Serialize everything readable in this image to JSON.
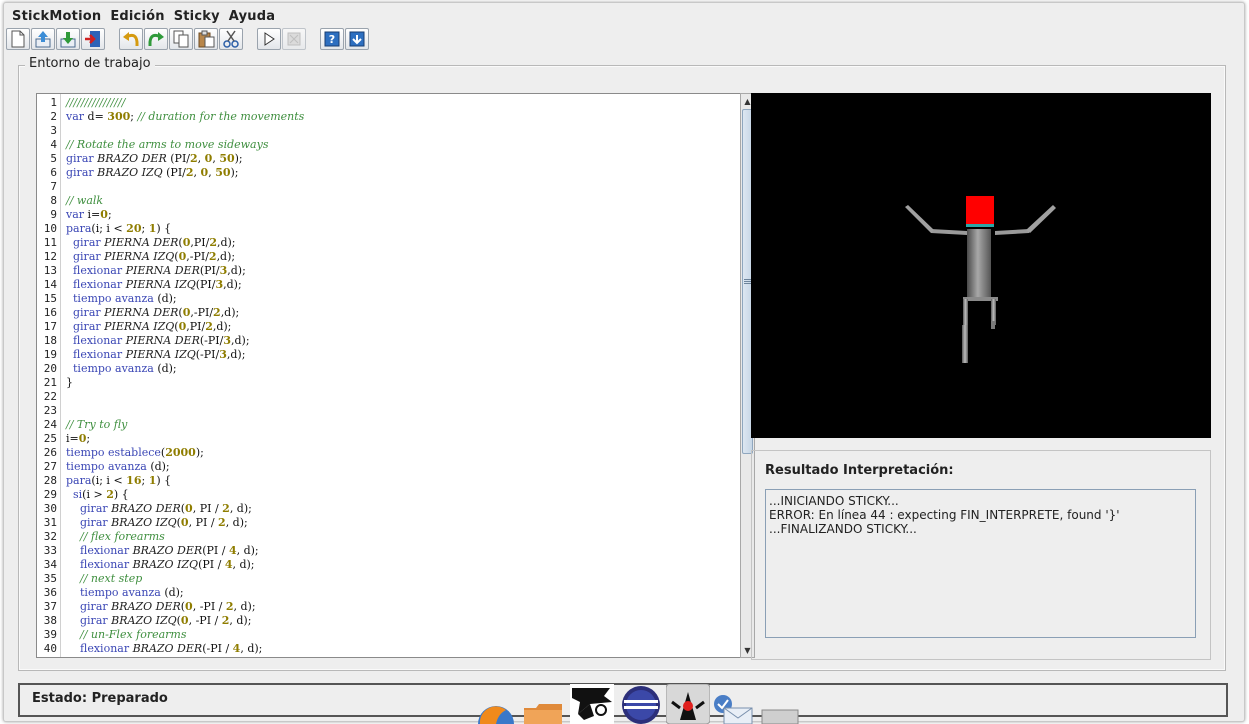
{
  "menu": [
    "StickMotion",
    "Edición",
    "Sticky",
    "Ayuda"
  ],
  "toolbar": [
    {
      "name": "new-file-icon",
      "disabled": false
    },
    {
      "name": "open-file-icon",
      "disabled": false
    },
    {
      "name": "save-file-icon",
      "disabled": false
    },
    {
      "name": "exit-icon",
      "disabled": false
    },
    {
      "gap": true
    },
    {
      "name": "undo-icon",
      "disabled": false
    },
    {
      "name": "redo-icon",
      "disabled": false
    },
    {
      "name": "copy-icon",
      "disabled": false
    },
    {
      "name": "paste-icon",
      "disabled": false
    },
    {
      "name": "cut-icon",
      "disabled": false
    },
    {
      "gap": true
    },
    {
      "name": "play-icon",
      "disabled": false
    },
    {
      "name": "stop-icon",
      "disabled": true
    },
    {
      "gap": true
    },
    {
      "name": "help-icon",
      "disabled": false
    },
    {
      "name": "info-icon",
      "disabled": false
    }
  ],
  "workspace_title": "Entorno de trabajo",
  "code_lines": [
    [
      [
        "c",
        "////////////////"
      ]
    ],
    [
      [
        "k",
        "var "
      ],
      [
        "p",
        "d= "
      ],
      [
        "n",
        "300"
      ],
      [
        "p",
        "; "
      ],
      [
        "c",
        "// duration for the movements"
      ]
    ],
    [],
    [
      [
        "c",
        "// Rotate the arms to move sideways"
      ]
    ],
    [
      [
        "k",
        "girar "
      ],
      [
        "i",
        "BRAZO DER "
      ],
      [
        "p",
        "(PI/"
      ],
      [
        "n",
        "2"
      ],
      [
        "p",
        ", "
      ],
      [
        "n",
        "0"
      ],
      [
        "p",
        ", "
      ],
      [
        "n",
        "50"
      ],
      [
        "p",
        ");"
      ]
    ],
    [
      [
        "k",
        "girar "
      ],
      [
        "i",
        "BRAZO IZQ "
      ],
      [
        "p",
        "(PI/"
      ],
      [
        "n",
        "2"
      ],
      [
        "p",
        ", "
      ],
      [
        "n",
        "0"
      ],
      [
        "p",
        ", "
      ],
      [
        "n",
        "50"
      ],
      [
        "p",
        ");"
      ]
    ],
    [],
    [
      [
        "c",
        "// walk"
      ]
    ],
    [
      [
        "k",
        "var "
      ],
      [
        "p",
        "i="
      ],
      [
        "n",
        "0"
      ],
      [
        "p",
        ";"
      ]
    ],
    [
      [
        "k",
        "para"
      ],
      [
        "p",
        "(i; i < "
      ],
      [
        "n",
        "20"
      ],
      [
        "p",
        "; "
      ],
      [
        "n",
        "1"
      ],
      [
        "p",
        ") {"
      ]
    ],
    [
      [
        "p",
        "  "
      ],
      [
        "k",
        "girar "
      ],
      [
        "i",
        "PIERNA DER"
      ],
      [
        "p",
        "("
      ],
      [
        "n",
        "0"
      ],
      [
        "p",
        ",PI/"
      ],
      [
        "n",
        "2"
      ],
      [
        "p",
        ",d);"
      ]
    ],
    [
      [
        "p",
        "  "
      ],
      [
        "k",
        "girar "
      ],
      [
        "i",
        "PIERNA IZQ"
      ],
      [
        "p",
        "("
      ],
      [
        "n",
        "0"
      ],
      [
        "p",
        ",-PI/"
      ],
      [
        "n",
        "2"
      ],
      [
        "p",
        ",d);"
      ]
    ],
    [
      [
        "p",
        "  "
      ],
      [
        "k",
        "flexionar "
      ],
      [
        "i",
        "PIERNA DER"
      ],
      [
        "p",
        "(PI/"
      ],
      [
        "n",
        "3"
      ],
      [
        "p",
        ",d);"
      ]
    ],
    [
      [
        "p",
        "  "
      ],
      [
        "k",
        "flexionar "
      ],
      [
        "i",
        "PIERNA IZQ"
      ],
      [
        "p",
        "(PI/"
      ],
      [
        "n",
        "3"
      ],
      [
        "p",
        ",d);"
      ]
    ],
    [
      [
        "p",
        "  "
      ],
      [
        "k",
        "tiempo avanza "
      ],
      [
        "p",
        "(d);"
      ]
    ],
    [
      [
        "p",
        "  "
      ],
      [
        "k",
        "girar "
      ],
      [
        "i",
        "PIERNA DER"
      ],
      [
        "p",
        "("
      ],
      [
        "n",
        "0"
      ],
      [
        "p",
        ",-PI/"
      ],
      [
        "n",
        "2"
      ],
      [
        "p",
        ",d);"
      ]
    ],
    [
      [
        "p",
        "  "
      ],
      [
        "k",
        "girar "
      ],
      [
        "i",
        "PIERNA IZQ"
      ],
      [
        "p",
        "("
      ],
      [
        "n",
        "0"
      ],
      [
        "p",
        ",PI/"
      ],
      [
        "n",
        "2"
      ],
      [
        "p",
        ",d);"
      ]
    ],
    [
      [
        "p",
        "  "
      ],
      [
        "k",
        "flexionar "
      ],
      [
        "i",
        "PIERNA DER"
      ],
      [
        "p",
        "(-PI/"
      ],
      [
        "n",
        "3"
      ],
      [
        "p",
        ",d);"
      ]
    ],
    [
      [
        "p",
        "  "
      ],
      [
        "k",
        "flexionar "
      ],
      [
        "i",
        "PIERNA IZQ"
      ],
      [
        "p",
        "(-PI/"
      ],
      [
        "n",
        "3"
      ],
      [
        "p",
        ",d);"
      ]
    ],
    [
      [
        "p",
        "  "
      ],
      [
        "k",
        "tiempo avanza "
      ],
      [
        "p",
        "(d);"
      ]
    ],
    [
      [
        "p",
        "}"
      ]
    ],
    [],
    [],
    [
      [
        "c",
        "// Try to fly"
      ]
    ],
    [
      [
        "p",
        "i="
      ],
      [
        "n",
        "0"
      ],
      [
        "p",
        ";"
      ]
    ],
    [
      [
        "k",
        "tiempo establece"
      ],
      [
        "p",
        "("
      ],
      [
        "n",
        "2000"
      ],
      [
        "p",
        ");"
      ]
    ],
    [
      [
        "k",
        "tiempo avanza "
      ],
      [
        "p",
        "(d);"
      ]
    ],
    [
      [
        "k",
        "para"
      ],
      [
        "p",
        "(i; i < "
      ],
      [
        "n",
        "16"
      ],
      [
        "p",
        "; "
      ],
      [
        "n",
        "1"
      ],
      [
        "p",
        ") {"
      ]
    ],
    [
      [
        "p",
        "  "
      ],
      [
        "k",
        "si"
      ],
      [
        "p",
        "(i > "
      ],
      [
        "n",
        "2"
      ],
      [
        "p",
        ") {"
      ]
    ],
    [
      [
        "p",
        "    "
      ],
      [
        "k",
        "girar "
      ],
      [
        "i",
        "BRAZO DER"
      ],
      [
        "p",
        "("
      ],
      [
        "n",
        "0"
      ],
      [
        "p",
        ", PI / "
      ],
      [
        "n",
        "2"
      ],
      [
        "p",
        ", d);"
      ]
    ],
    [
      [
        "p",
        "    "
      ],
      [
        "k",
        "girar "
      ],
      [
        "i",
        "BRAZO IZQ"
      ],
      [
        "p",
        "("
      ],
      [
        "n",
        "0"
      ],
      [
        "p",
        ", PI / "
      ],
      [
        "n",
        "2"
      ],
      [
        "p",
        ", d);"
      ]
    ],
    [
      [
        "p",
        "    "
      ],
      [
        "c",
        "// flex forearms"
      ]
    ],
    [
      [
        "p",
        "    "
      ],
      [
        "k",
        "flexionar "
      ],
      [
        "i",
        "BRAZO DER"
      ],
      [
        "p",
        "(PI / "
      ],
      [
        "n",
        "4"
      ],
      [
        "p",
        ", d);"
      ]
    ],
    [
      [
        "p",
        "    "
      ],
      [
        "k",
        "flexionar "
      ],
      [
        "i",
        "BRAZO IZQ"
      ],
      [
        "p",
        "(PI / "
      ],
      [
        "n",
        "4"
      ],
      [
        "p",
        ", d);"
      ]
    ],
    [
      [
        "p",
        "    "
      ],
      [
        "c",
        "// next step"
      ]
    ],
    [
      [
        "p",
        "    "
      ],
      [
        "k",
        "tiempo avanza "
      ],
      [
        "p",
        "(d);"
      ]
    ],
    [
      [
        "p",
        "    "
      ],
      [
        "k",
        "girar "
      ],
      [
        "i",
        "BRAZO DER"
      ],
      [
        "p",
        "("
      ],
      [
        "n",
        "0"
      ],
      [
        "p",
        ", -PI / "
      ],
      [
        "n",
        "2"
      ],
      [
        "p",
        ", d);"
      ]
    ],
    [
      [
        "p",
        "    "
      ],
      [
        "k",
        "girar "
      ],
      [
        "i",
        "BRAZO IZQ"
      ],
      [
        "p",
        "("
      ],
      [
        "n",
        "0"
      ],
      [
        "p",
        ", -PI / "
      ],
      [
        "n",
        "2"
      ],
      [
        "p",
        ", d);"
      ]
    ],
    [
      [
        "p",
        "    "
      ],
      [
        "c",
        "// un-Flex forearms"
      ]
    ],
    [
      [
        "p",
        "    "
      ],
      [
        "k",
        "flexionar "
      ],
      [
        "i",
        "BRAZO DER"
      ],
      [
        "p",
        "(-PI / "
      ],
      [
        "n",
        "4"
      ],
      [
        "p",
        ", d);"
      ]
    ]
  ],
  "colors": {
    "comment": "#3f8f3f",
    "keyword": "#3b47b5",
    "number": "#8f7d00",
    "head": "#ff0000",
    "limb": "#9a9a9a"
  },
  "result": {
    "title": "Resultado Interpretación:",
    "lines": [
      "...INICIANDO STICKY...",
      "ERROR: En línea 44 : expecting FIN_INTERPRETE, found '}'",
      "...FINALIZANDO STICKY..."
    ]
  },
  "status": {
    "label": "Estado:",
    "value": "Preparado"
  },
  "dock": [
    "firefox-icon",
    "folder-icon",
    "inkscape-icon",
    "eclipse-icon",
    "java-duke-icon",
    "mail-check-icon",
    "app-icon"
  ]
}
